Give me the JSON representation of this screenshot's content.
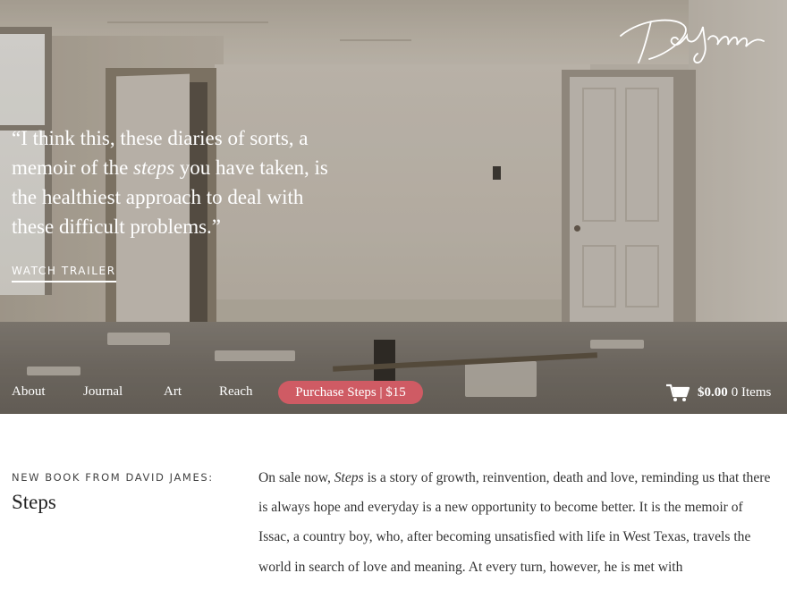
{
  "brand": {
    "logo_text": "David James"
  },
  "hero": {
    "quote_before": "“I think this, these diaries of sorts, a memoir of the ",
    "quote_em": "steps",
    "quote_after": " you have taken, is the healthiest approach to deal with these difficult problems.”",
    "cta_label": "WATCH TRAILER"
  },
  "nav": {
    "items": [
      {
        "label": "About"
      },
      {
        "label": "Journal"
      },
      {
        "label": "Art"
      },
      {
        "label": "Reach"
      }
    ],
    "purchase_label": "Purchase Steps | $15",
    "purchase_color": "#cf5b64",
    "cart": {
      "icon": "cart-icon",
      "total": "$0.00",
      "items": "0 Items"
    }
  },
  "book": {
    "eyebrow": "NEW BOOK FROM DAVID JAMES:",
    "title": "Steps",
    "desc_start": "On sale now, ",
    "desc_em": "Steps",
    "desc_rest": " is a story of growth, reinvention, death and love, reminding us that there is always hope and everyday is a new opportunity to become better. It is the memoir of Issac, a country boy, who, after becoming unsatisfied with life in West Texas, travels the world in search of love and meaning. At every turn, however, he is met with"
  }
}
